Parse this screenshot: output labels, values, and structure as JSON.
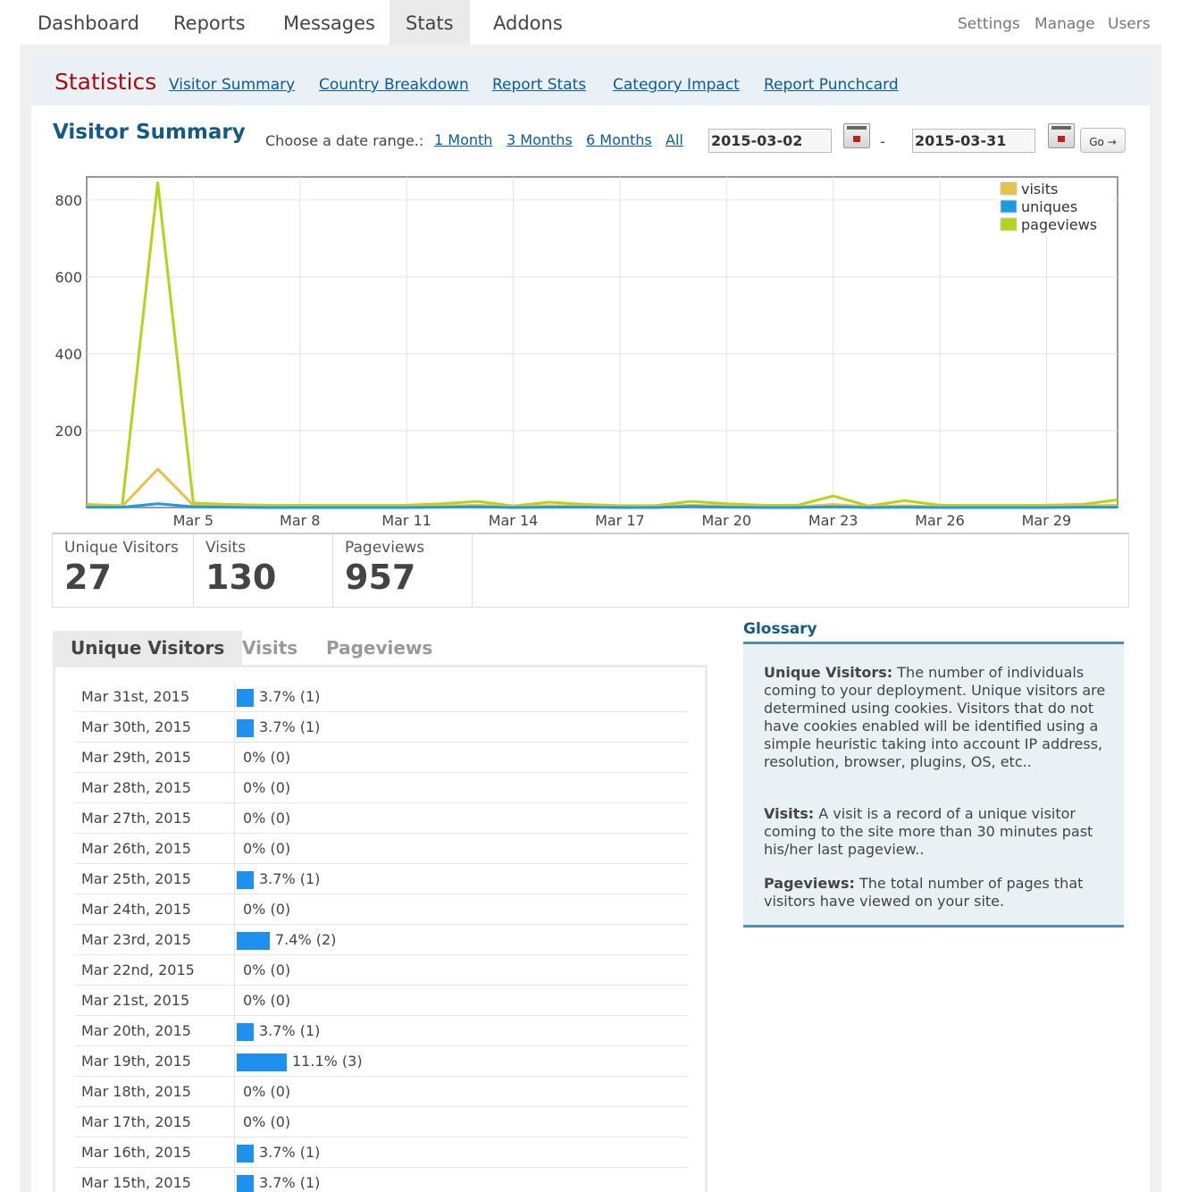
{
  "topnav": {
    "tabs": [
      "Dashboard",
      "Reports",
      "Messages",
      "Stats",
      "Addons"
    ],
    "active": "Stats",
    "right_links": [
      "Settings",
      "Manage",
      "Users"
    ]
  },
  "subnav": {
    "title": "Statistics",
    "links": [
      "Visitor Summary",
      "Country Breakdown",
      "Report Stats",
      "Category Impact",
      "Report Punchcard"
    ]
  },
  "section": {
    "title": "Visitor Summary",
    "range_label": "Choose a date range.:",
    "range_links": [
      "1 Month",
      "3 Months",
      "6 Months",
      "All"
    ],
    "start_date": "2015-03-02",
    "end_date": "2015-03-31",
    "separator": "-",
    "go_label": "Go →",
    "calendar_icon": "calendar-icon"
  },
  "chart_data": {
    "type": "line",
    "x": [
      "Mar 2",
      "Mar 3",
      "Mar 4",
      "Mar 5",
      "Mar 6",
      "Mar 7",
      "Mar 8",
      "Mar 9",
      "Mar 10",
      "Mar 11",
      "Mar 12",
      "Mar 13",
      "Mar 14",
      "Mar 15",
      "Mar 16",
      "Mar 17",
      "Mar 18",
      "Mar 19",
      "Mar 20",
      "Mar 21",
      "Mar 22",
      "Mar 23",
      "Mar 24",
      "Mar 25",
      "Mar 26",
      "Mar 27",
      "Mar 28",
      "Mar 29",
      "Mar 30",
      "Mar 31"
    ],
    "xticks": [
      "Mar 5",
      "Mar 8",
      "Mar 11",
      "Mar 14",
      "Mar 17",
      "Mar 20",
      "Mar 23",
      "Mar 26",
      "Mar 29"
    ],
    "yticks": [
      200,
      400,
      600,
      800
    ],
    "ylim": [
      0,
      860
    ],
    "grid": true,
    "legend_position": "top-right",
    "series": [
      {
        "name": "visits",
        "color": "#e8c14a",
        "values": [
          3,
          3,
          100,
          6,
          3,
          2,
          2,
          2,
          2,
          2,
          4,
          6,
          2,
          5,
          3,
          2,
          2,
          6,
          4,
          2,
          2,
          8,
          2,
          5,
          2,
          2,
          2,
          2,
          4,
          6
        ]
      },
      {
        "name": "uniques",
        "color": "#1e9ae0",
        "values": [
          1,
          1,
          10,
          2,
          1,
          0,
          0,
          0,
          0,
          0,
          1,
          2,
          0,
          1,
          1,
          0,
          0,
          3,
          1,
          0,
          0,
          2,
          0,
          1,
          0,
          0,
          0,
          0,
          1,
          1
        ]
      },
      {
        "name": "pageviews",
        "color": "#b6d31c",
        "values": [
          8,
          5,
          845,
          12,
          8,
          6,
          6,
          6,
          6,
          6,
          10,
          16,
          4,
          14,
          8,
          5,
          5,
          16,
          10,
          6,
          6,
          30,
          4,
          18,
          6,
          6,
          6,
          6,
          8,
          20
        ]
      }
    ]
  },
  "totals": [
    {
      "label": "Unique Visitors",
      "value": "27"
    },
    {
      "label": "Visits",
      "value": "130"
    },
    {
      "label": "Pageviews",
      "value": "957"
    }
  ],
  "breakdown": {
    "tabs": [
      "Unique Visitors",
      "Visits",
      "Pageviews"
    ],
    "active": "Unique Visitors",
    "bar_color": "#1e90ee",
    "rows": [
      {
        "date": "Mar 31st, 2015",
        "label": "3.7% (1)",
        "pct": 3.7
      },
      {
        "date": "Mar 30th, 2015",
        "label": "3.7% (1)",
        "pct": 3.7
      },
      {
        "date": "Mar 29th, 2015",
        "label": "0% (0)",
        "pct": 0
      },
      {
        "date": "Mar 28th, 2015",
        "label": "0% (0)",
        "pct": 0
      },
      {
        "date": "Mar 27th, 2015",
        "label": "0% (0)",
        "pct": 0
      },
      {
        "date": "Mar 26th, 2015",
        "label": "0% (0)",
        "pct": 0
      },
      {
        "date": "Mar 25th, 2015",
        "label": "3.7% (1)",
        "pct": 3.7
      },
      {
        "date": "Mar 24th, 2015",
        "label": "0% (0)",
        "pct": 0
      },
      {
        "date": "Mar 23rd, 2015",
        "label": "7.4% (2)",
        "pct": 7.4
      },
      {
        "date": "Mar 22nd, 2015",
        "label": "0% (0)",
        "pct": 0
      },
      {
        "date": "Mar 21st, 2015",
        "label": "0% (0)",
        "pct": 0
      },
      {
        "date": "Mar 20th, 2015",
        "label": "3.7% (1)",
        "pct": 3.7
      },
      {
        "date": "Mar 19th, 2015",
        "label": "11.1% (3)",
        "pct": 11.1
      },
      {
        "date": "Mar 18th, 2015",
        "label": "0% (0)",
        "pct": 0
      },
      {
        "date": "Mar 17th, 2015",
        "label": "0% (0)",
        "pct": 0
      },
      {
        "date": "Mar 16th, 2015",
        "label": "3.7% (1)",
        "pct": 3.7
      },
      {
        "date": "Mar 15th, 2015",
        "label": "3.7% (1)",
        "pct": 3.7
      }
    ]
  },
  "glossary": {
    "title": "Glossary",
    "entries": [
      {
        "term": "Unique Visitors:",
        "text": "The number of individuals coming to your deployment. Unique visitors are determined using cookies. Visitors that do not have cookies enabled will be identified using a simple heuristic taking into account IP address, resolution, browser, plugins, OS, etc.."
      },
      {
        "term": "Visits:",
        "text": "A visit is a record of a unique visitor coming to the site more than 30 minutes past his/her last pageview.."
      },
      {
        "term": "Pageviews:",
        "text": "The total number of pages that visitors have viewed on your site."
      }
    ]
  }
}
